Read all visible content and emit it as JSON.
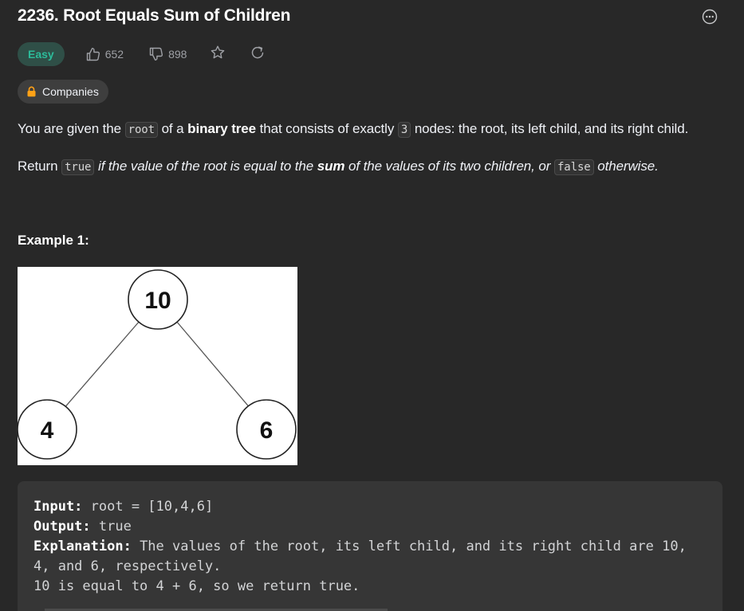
{
  "problem": {
    "title": "2236. Root Equals Sum of Children",
    "difficulty": "Easy",
    "likes": "652",
    "dislikes": "898",
    "companies_label": "Companies"
  },
  "description": {
    "p1": {
      "t1": "You are given the ",
      "c1": "root",
      "t2": " of a ",
      "b1": "binary tree",
      "t3": " that consists of exactly ",
      "c2": "3",
      "t4": " nodes: the root, its left child, and its right child."
    },
    "p2": {
      "t1": "Return ",
      "c1": "true",
      "i1": " if the value of the root is equal to the ",
      "b1": "sum",
      "i2": " of the values of its two children, or ",
      "c2": "false",
      "i3": " otherwise."
    }
  },
  "example1": {
    "heading": "Example 1:",
    "tree": {
      "root": "10",
      "left": "4",
      "right": "6"
    },
    "input_label": "Input:",
    "input_value": " root = [10,4,6]",
    "output_label": "Output:",
    "output_value": " true",
    "explanation_label": "Explanation:",
    "explanation_line1": " The values of the root, its left child, and its right child are 10,",
    "explanation_line2": "4, and 6, respectively.",
    "explanation_line3": "10 is equal to 4 + 6, so we return true."
  },
  "icons": {
    "more": "more-options-icon",
    "like": "thumbs-up-icon",
    "dislike": "thumbs-down-icon",
    "star": "star-icon",
    "share": "share-icon",
    "lock": "lock-icon"
  },
  "colors": {
    "background": "#282828",
    "easy": "#2cbb9a",
    "easy_bg": "#2f4f47",
    "lock": "#ffa116"
  }
}
